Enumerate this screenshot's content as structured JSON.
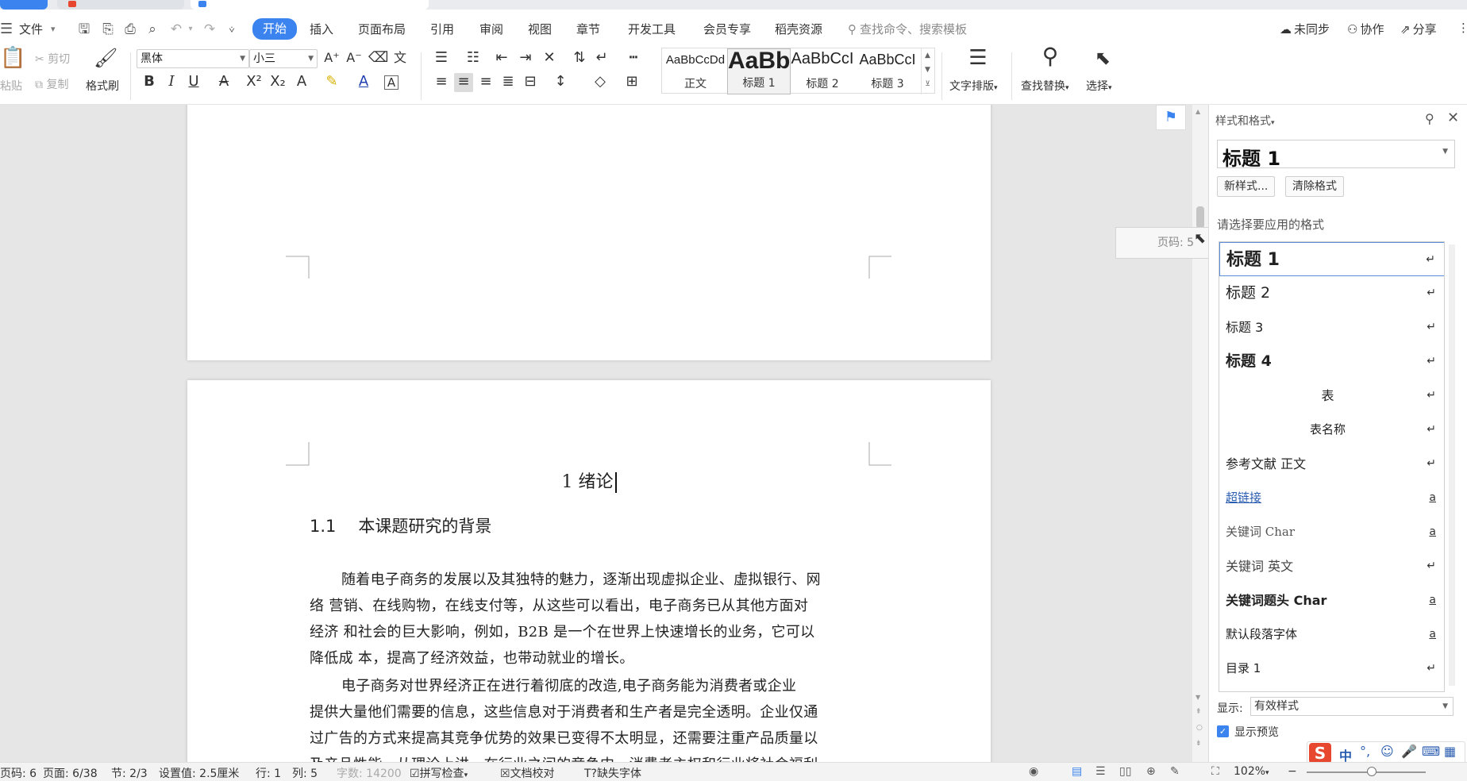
{
  "window": {
    "tabs": [
      "",
      "",
      ""
    ]
  },
  "menu": {
    "file": "文件",
    "items": [
      "开始",
      "插入",
      "页面布局",
      "引用",
      "审阅",
      "视图",
      "章节",
      "开发工具",
      "会员专享",
      "稻壳资源"
    ],
    "active_index": 0,
    "search_placeholder": "查找命令、搜索模板",
    "right": {
      "sync": "未同步",
      "collab": "协作",
      "share": "分享"
    }
  },
  "ribbon": {
    "paste": "粘贴",
    "cut": "剪切",
    "copy": "复制",
    "format_painter": "格式刷",
    "font_name": "黑体",
    "font_size": "小三",
    "styles": [
      {
        "preview": "AaBbCcDd",
        "label": "正文"
      },
      {
        "preview": "AaBb",
        "label": "标题 1"
      },
      {
        "preview": "AaBbCcI",
        "label": "标题 2"
      },
      {
        "preview": "AaBbCcI",
        "label": "标题 3"
      }
    ],
    "text_layout": "文字排版",
    "find_replace": "查找替换",
    "select": "选择"
  },
  "document": {
    "chapter_title": "1  绪论",
    "section_number": "1.1",
    "section_title": "本课题研究的背景",
    "lines": [
      "随着电子商务的发展以及其独特的魅力，逐渐出现虚拟企业、虚拟银行、网",
      "络 营销、在线购物，在线支付等，从这些可以看出，电子商务已从其他方面对",
      "经济 和社会的巨大影响，例如，B2B 是一个在世界上快速增长的业务，它可以",
      "降低成 本，提高了经济效益，也带动就业的增长。",
      "电子商务对世界经济正在进行着彻底的改造,电子商务能为消费者或企业",
      "提供大量他们需要的信息，这些信息对于消费者和生产者是完全透明。企业仅通",
      "过广告的方式来提高其竞争优势的效果已变得不太明显，还需要注重产品质量以",
      "及产品性能。从理论上讲，在行业之间的竞争中，消费者主权和行业将社会福利"
    ]
  },
  "tooltip": "页码: 5",
  "panel": {
    "title": "样式和格式",
    "current_style": "标题  1",
    "new_style": "新样式...",
    "clear_format": "清除格式",
    "prompt": "请选择要应用的格式",
    "styles": [
      {
        "name": "标题  1",
        "mark": "↵"
      },
      {
        "name": "标题  2",
        "mark": "↵"
      },
      {
        "name": "标题  3",
        "mark": "↵"
      },
      {
        "name": "标题  4",
        "mark": "↵"
      },
      {
        "name": "表",
        "mark": "↵"
      },
      {
        "name": "表名称",
        "mark": "↵"
      },
      {
        "name": "参考文献  正文",
        "mark": "↵"
      },
      {
        "name": "超链接",
        "mark": "a"
      },
      {
        "name": "关键词 Char",
        "mark": "a"
      },
      {
        "name": "关键词  英文",
        "mark": "↵"
      },
      {
        "name": "关键词题头 Char",
        "mark": "a"
      },
      {
        "name": "默认段落字体",
        "mark": "a"
      },
      {
        "name": "目录  1",
        "mark": "↵"
      }
    ],
    "show_label": "显示:",
    "show_value": "有效样式",
    "preview_label": "显示预览",
    "preview_checked": true
  },
  "status": {
    "page_code": "页码: 6",
    "page": "页面: 6/38",
    "section": "节: 2/3",
    "setting": "设置值: 2.5厘米",
    "row": "行: 1",
    "col": "列: 5",
    "words": "字数: 14200",
    "spell": "拼写检查",
    "proof": "文档校对",
    "missing_font": "缺失字体",
    "zoom": "102%"
  },
  "colors": {
    "accent": "#3b84f0",
    "link": "#2a5db0",
    "ime_red": "#e8472f"
  }
}
